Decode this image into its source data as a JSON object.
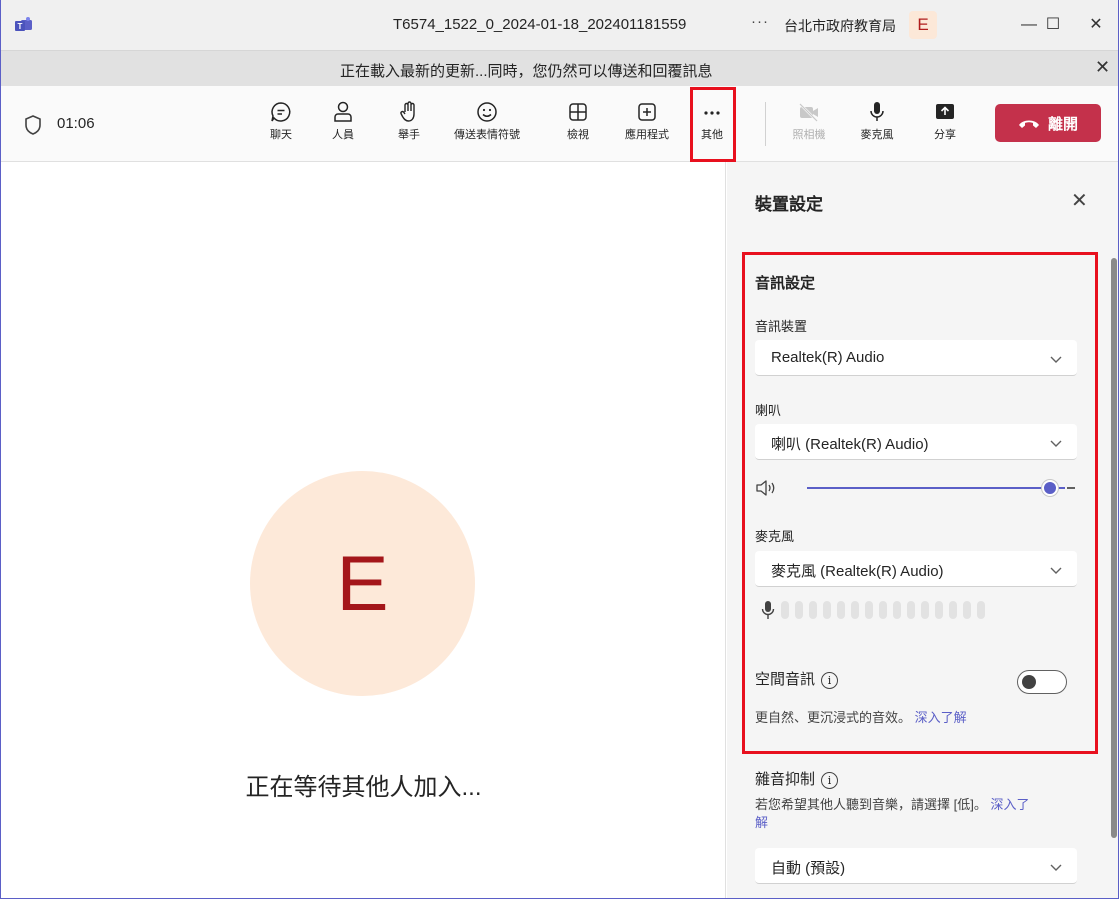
{
  "window": {
    "title": "T6574_1522_0_2024-01-18_202401181559",
    "more_dots": "···",
    "org": "台北市政府教育局",
    "avatar_initial": "E",
    "minimize": "—",
    "maximize": "☐",
    "close": "✕"
  },
  "notice": {
    "text": "正在載入最新的更新...同時，您仍然可以傳送和回覆訊息",
    "close": "✕"
  },
  "toolbar": {
    "timer": "01:06",
    "buttons": {
      "chat": "聊天",
      "people": "人員",
      "raise_hand": "舉手",
      "reactions": "傳送表情符號",
      "view": "檢視",
      "apps": "應用程式",
      "more": "其他",
      "camera": "照相機",
      "mic": "麥克風",
      "share": "分享"
    },
    "leave": "離開"
  },
  "stage": {
    "avatar_initial": "E",
    "waiting_text": "正在等待其他人加入..."
  },
  "panel": {
    "title": "裝置設定",
    "close": "✕",
    "audio_settings_title": "音訊設定",
    "audio_device_label": "音訊裝置",
    "audio_device_value": "Realtek(R) Audio",
    "speaker_label": "喇叭",
    "speaker_value": "喇叭 (Realtek(R) Audio)",
    "speaker_volume": 0.94,
    "mic_label": "麥克風",
    "mic_value": "麥克風 (Realtek(R) Audio)",
    "spatial_audio_label": "空間音訊",
    "spatial_audio_on": false,
    "spatial_audio_desc": "更自然、更沉浸式的音效。",
    "learn_more": "深入了解",
    "noise_label": "雜音抑制",
    "noise_desc": "若您希望其他人聽到音樂，請選擇 [低]。",
    "noise_learn_more_1": "深入了",
    "noise_learn_more_2": "解",
    "noise_value": "自動 (預設)",
    "info_glyph": "i"
  },
  "colors": {
    "accent": "#5b5fc7",
    "leave_red": "#c4314b",
    "highlight_red": "#e8101e",
    "avatar_bg": "#fde9d9",
    "avatar_text": "#a4161a"
  }
}
